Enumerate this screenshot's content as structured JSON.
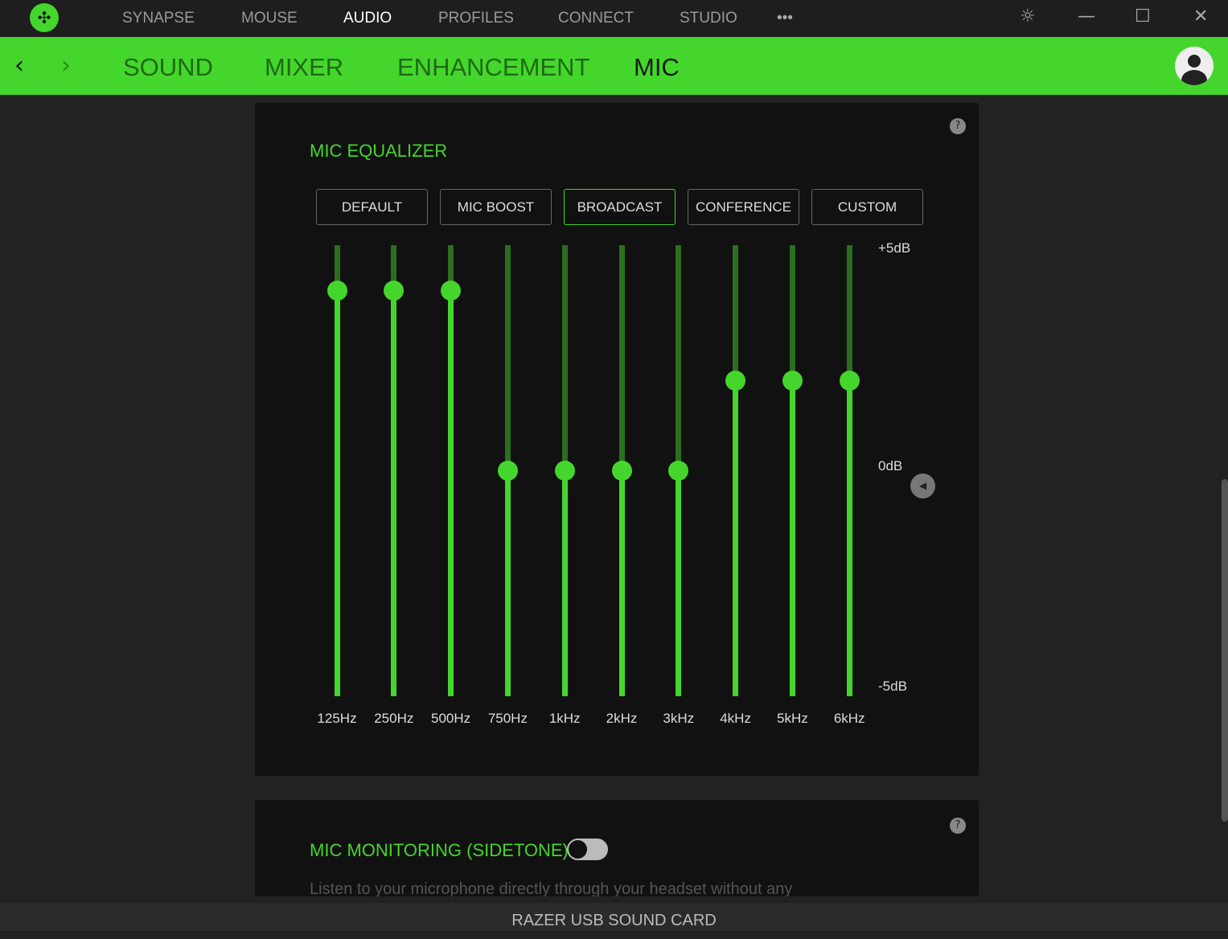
{
  "top_nav": {
    "items": [
      {
        "label": "SYNAPSE"
      },
      {
        "label": "MOUSE"
      },
      {
        "label": "AUDIO",
        "active": true
      },
      {
        "label": "PROFILES"
      },
      {
        "label": "CONNECT"
      },
      {
        "label": "STUDIO"
      }
    ],
    "more": "•••"
  },
  "window": {
    "settings_icon": "gear-icon",
    "minimize": "—",
    "maximize": "☐",
    "close": "✕"
  },
  "sub_nav": {
    "items": [
      {
        "label": "SOUND"
      },
      {
        "label": "MIXER"
      },
      {
        "label": "ENHANCEMENT"
      },
      {
        "label": "MIC",
        "active": true
      }
    ],
    "back": "‹",
    "forward": "›"
  },
  "accent": "#44d62c",
  "equalizer": {
    "title": "MIC EQUALIZER",
    "help": "?",
    "presets": [
      {
        "label": "DEFAULT"
      },
      {
        "label": "MIC BOOST"
      },
      {
        "label": "BROADCAST",
        "active": true
      },
      {
        "label": "CONFERENCE"
      },
      {
        "label": "CUSTOM"
      }
    ],
    "db_labels": {
      "max": "+5dB",
      "zero": "0dB",
      "min": "-5dB"
    },
    "range": [
      -5,
      5
    ],
    "bands": [
      {
        "label": "125Hz",
        "value": 4
      },
      {
        "label": "250Hz",
        "value": 4
      },
      {
        "label": "500Hz",
        "value": 4
      },
      {
        "label": "750Hz",
        "value": 0
      },
      {
        "label": "1kHz",
        "value": 0
      },
      {
        "label": "2kHz",
        "value": 0
      },
      {
        "label": "3kHz",
        "value": 0
      },
      {
        "label": "4kHz",
        "value": 2
      },
      {
        "label": "5kHz",
        "value": 2
      },
      {
        "label": "6kHz",
        "value": 2
      }
    ],
    "collapse_icon": "◀"
  },
  "monitoring": {
    "title": "MIC MONITORING (SIDETONE)",
    "enabled": false,
    "help": "?",
    "description": "Listen to your microphone directly through your headset without any"
  },
  "device": "RAZER USB SOUND CARD"
}
